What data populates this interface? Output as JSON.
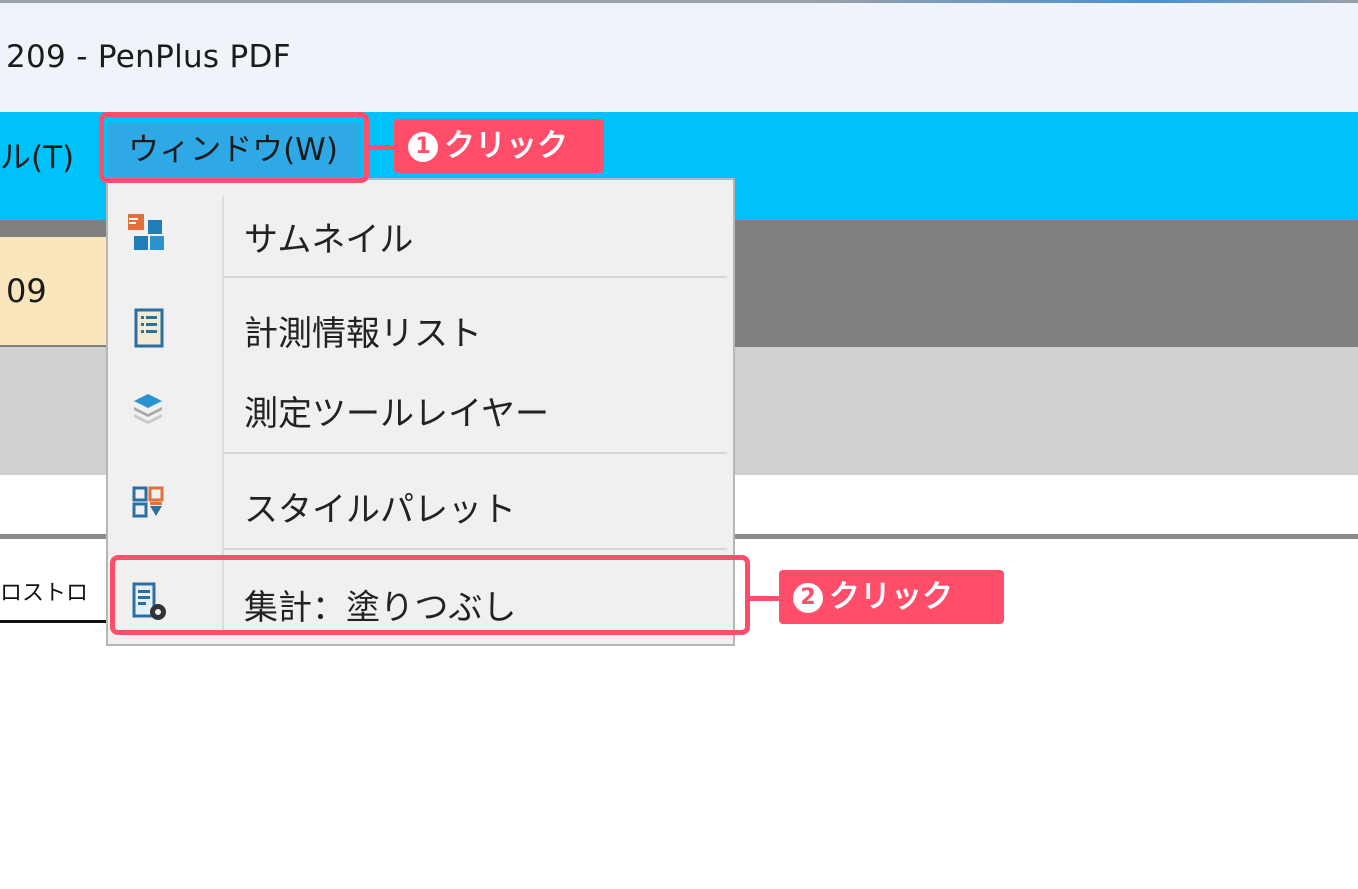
{
  "window": {
    "title": "209 - PenPlus PDF"
  },
  "menubar": {
    "tools_label": "ル(T)",
    "window_label": "ウィンドウ(W)"
  },
  "document": {
    "tab_label": "09"
  },
  "lower_tab": {
    "label": "ロストロ"
  },
  "dropdown": {
    "items": [
      {
        "label": "サムネイル",
        "icon": "thumbnail-icon"
      },
      {
        "label": "計測情報リスト",
        "icon": "measurement-list-icon"
      },
      {
        "label": "測定ツールレイヤー",
        "icon": "layers-icon"
      },
      {
        "label": "スタイルパレット",
        "icon": "style-palette-icon"
      },
      {
        "label": "集計：塗りつぶし",
        "icon": "aggregate-fill-icon"
      }
    ]
  },
  "annotations": {
    "step1": {
      "number": "1",
      "text": "クリック"
    },
    "step2": {
      "number": "2",
      "text": "クリック"
    }
  },
  "colors": {
    "menubar": "#00c2fb",
    "highlight": "#ff4d6a",
    "menu_bg": "#f0f0f0",
    "doc_tab": "#fae6bd"
  }
}
